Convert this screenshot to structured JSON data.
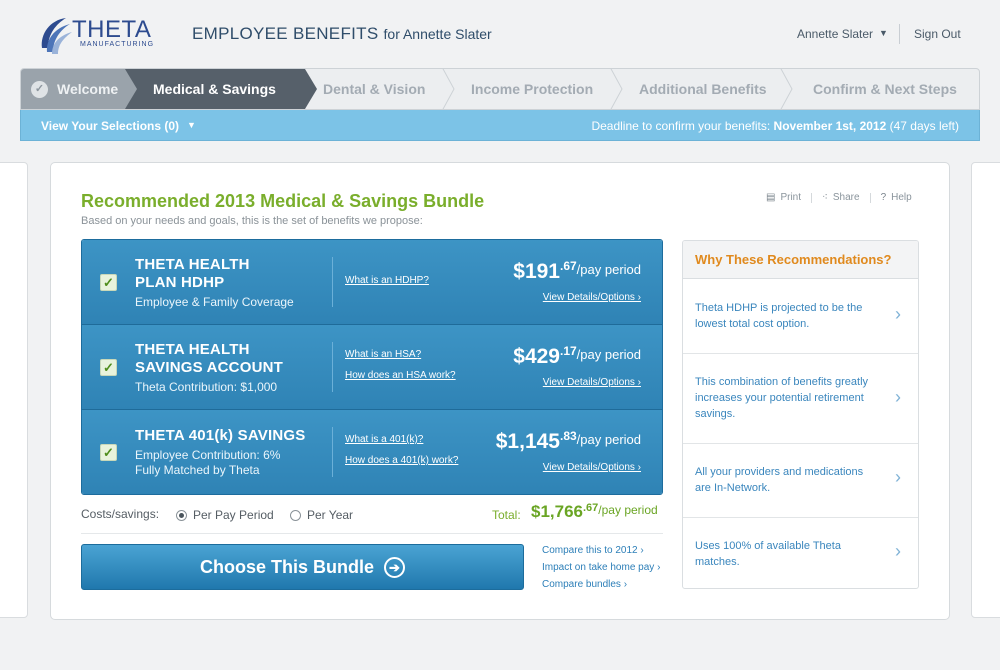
{
  "header": {
    "logo_word": "THETA",
    "logo_sub": "MANUFACTURING",
    "app_title": "EMPLOYEE BENEFITS",
    "app_title_for": "for Annette Slater",
    "user_name": "Annette Slater",
    "sign_out": "Sign Out"
  },
  "steps": [
    {
      "label": "Welcome",
      "state": "complete"
    },
    {
      "label": "Medical & Savings",
      "state": "active"
    },
    {
      "label": "Dental & Vision",
      "state": "upcoming"
    },
    {
      "label": "Income Protection",
      "state": "upcoming"
    },
    {
      "label": "Additional Benefits",
      "state": "upcoming"
    },
    {
      "label": "Confirm & Next Steps",
      "state": "upcoming"
    }
  ],
  "selection_bar": {
    "view_selections": "View Your Selections (0)",
    "deadline_prefix": "Deadline to confirm your benefits:",
    "deadline_date": "November 1st, 2012",
    "deadline_days": "(47 days left)"
  },
  "card": {
    "title": "Recommended 2013 Medical & Savings Bundle",
    "subtitle": "Based on your needs and goals, this is the set of benefits we propose:",
    "tools": {
      "print": "Print",
      "share": "Share",
      "help": "Help"
    }
  },
  "benefits": [
    {
      "title_line1": "THETA HEALTH",
      "title_line2": "PLAN HDHP",
      "desc_line1": "Employee & Family Coverage",
      "desc_line2": "",
      "link1": "What is an HDHP?",
      "link2": "",
      "price_dollars": "$191",
      "price_cents": ".67",
      "price_per": "/pay period",
      "details": "View Details/Options ›"
    },
    {
      "title_line1": "THETA HEALTH",
      "title_line2": "SAVINGS ACCOUNT",
      "desc_line1": "Theta Contribution: $1,000",
      "desc_line2": "",
      "link1": "What is an HSA?",
      "link2": "How does an HSA work?",
      "price_dollars": "$429",
      "price_cents": ".17",
      "price_per": "/pay period",
      "details": "View Details/Options ›"
    },
    {
      "title_line1": "THETA 401(k) SAVINGS",
      "title_line2": "",
      "desc_line1": "Employee Contribution: 6%",
      "desc_line2": "Fully Matched by Theta",
      "link1": "What is a 401(k)?",
      "link2": "How does a 401(k) work?",
      "price_dollars": "$1,145",
      "price_cents": ".83",
      "price_per": "/pay period",
      "details": "View Details/Options ›"
    }
  ],
  "costs": {
    "label": "Costs/savings:",
    "option_pay_period": "Per Pay Period",
    "option_year": "Per Year",
    "selected": "Per Pay Period",
    "total_label": "Total:",
    "total_dollars": "$1,766",
    "total_cents": ".67",
    "total_per": "/pay period"
  },
  "choose_button": "Choose This Bundle",
  "compare_links": [
    "Compare this to 2012 ›",
    "Impact on take home pay ›",
    "Compare bundles ›"
  ],
  "why": {
    "title": "Why These Recommendations?",
    "items": [
      "Theta HDHP is projected to be the lowest total cost option.",
      "This combination of benefits greatly increases your potential retirement savings.",
      "All your providers and medications are In-Network.",
      "Uses 100% of available Theta matches."
    ]
  },
  "colors": {
    "accent_green": "#7aae2c",
    "benefit_blue": "#3d94c5",
    "selection_bar": "#7cc3e7",
    "why_orange": "#e08a1e"
  }
}
